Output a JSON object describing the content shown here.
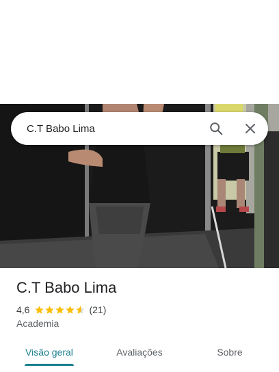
{
  "search": {
    "query": "C.T Babo Lima",
    "search_icon": "search-icon",
    "close_icon": "close-icon"
  },
  "photo": {
    "kind": "gym-mirror-photo"
  },
  "place": {
    "name": "C.T Babo Lima",
    "rating": "4,6",
    "rating_value": 4.6,
    "stars_max": 5,
    "review_count": "(21)",
    "category": "Academia"
  },
  "tabs": [
    {
      "label": "Visão geral",
      "active": true
    },
    {
      "label": "Avaliações",
      "active": false
    },
    {
      "label": "Sobre",
      "active": false
    }
  ],
  "colors": {
    "accent": "#1a7f8c",
    "star": "#fbbc04",
    "star_empty": "#dadce0"
  }
}
